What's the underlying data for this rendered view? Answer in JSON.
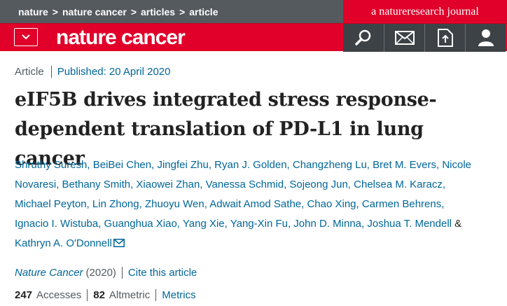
{
  "breadcrumb": [
    "nature",
    "nature cancer",
    "articles",
    "article"
  ],
  "breadcrumb_separator": ">",
  "journal_brand": "a natureresearch journal",
  "logo": "nature cancer",
  "header_icons": [
    "search-icon",
    "mail-icon",
    "download-icon",
    "user-icon"
  ],
  "article": {
    "type": "Article",
    "published": "Published: 20 April 2020",
    "title": "eIF5B drives integrated stress response-dependent translation of PD-L1 in lung cancer",
    "authors_line1": "Shruthy Suresh, BeiBei Chen, Jingfei Zhu, Ryan J. Golden, Changzheng Lu, Bret M. Evers, Nicole",
    "authors_line2": "Novaresi, Bethany Smith, Xiaowei Zhan, Vanessa Schmid, Sojeong Jun, Chelsea M. Karacz,",
    "authors_line3": "Michael Peyton, Lin Zhong, Zhuoyu Wen, Adwait Amod Sathe, Chao Xing, Carmen Behrens,",
    "authors_line4": "Ignacio I. Wistuba, Guanghua Xiao, Yang Xie, Yang-Xin Fu, John D. Minna, Joshua T. Mendell",
    "authors_amp": "&",
    "authors_line5": "Kathryn A. O'Donnell",
    "journal": "Nature Cancer",
    "year": "(2020)",
    "cite": "Cite this article",
    "accesses_count": "247",
    "accesses_label": "Accesses",
    "altmetric_count": "82",
    "altmetric_label": "Altmetric",
    "metrics_link": "Metrics"
  },
  "colors": {
    "brand_red": "#e0002a",
    "topbar_gray": "#555a5f",
    "link_blue": "#006699",
    "icon_bg": "#3d4246"
  }
}
